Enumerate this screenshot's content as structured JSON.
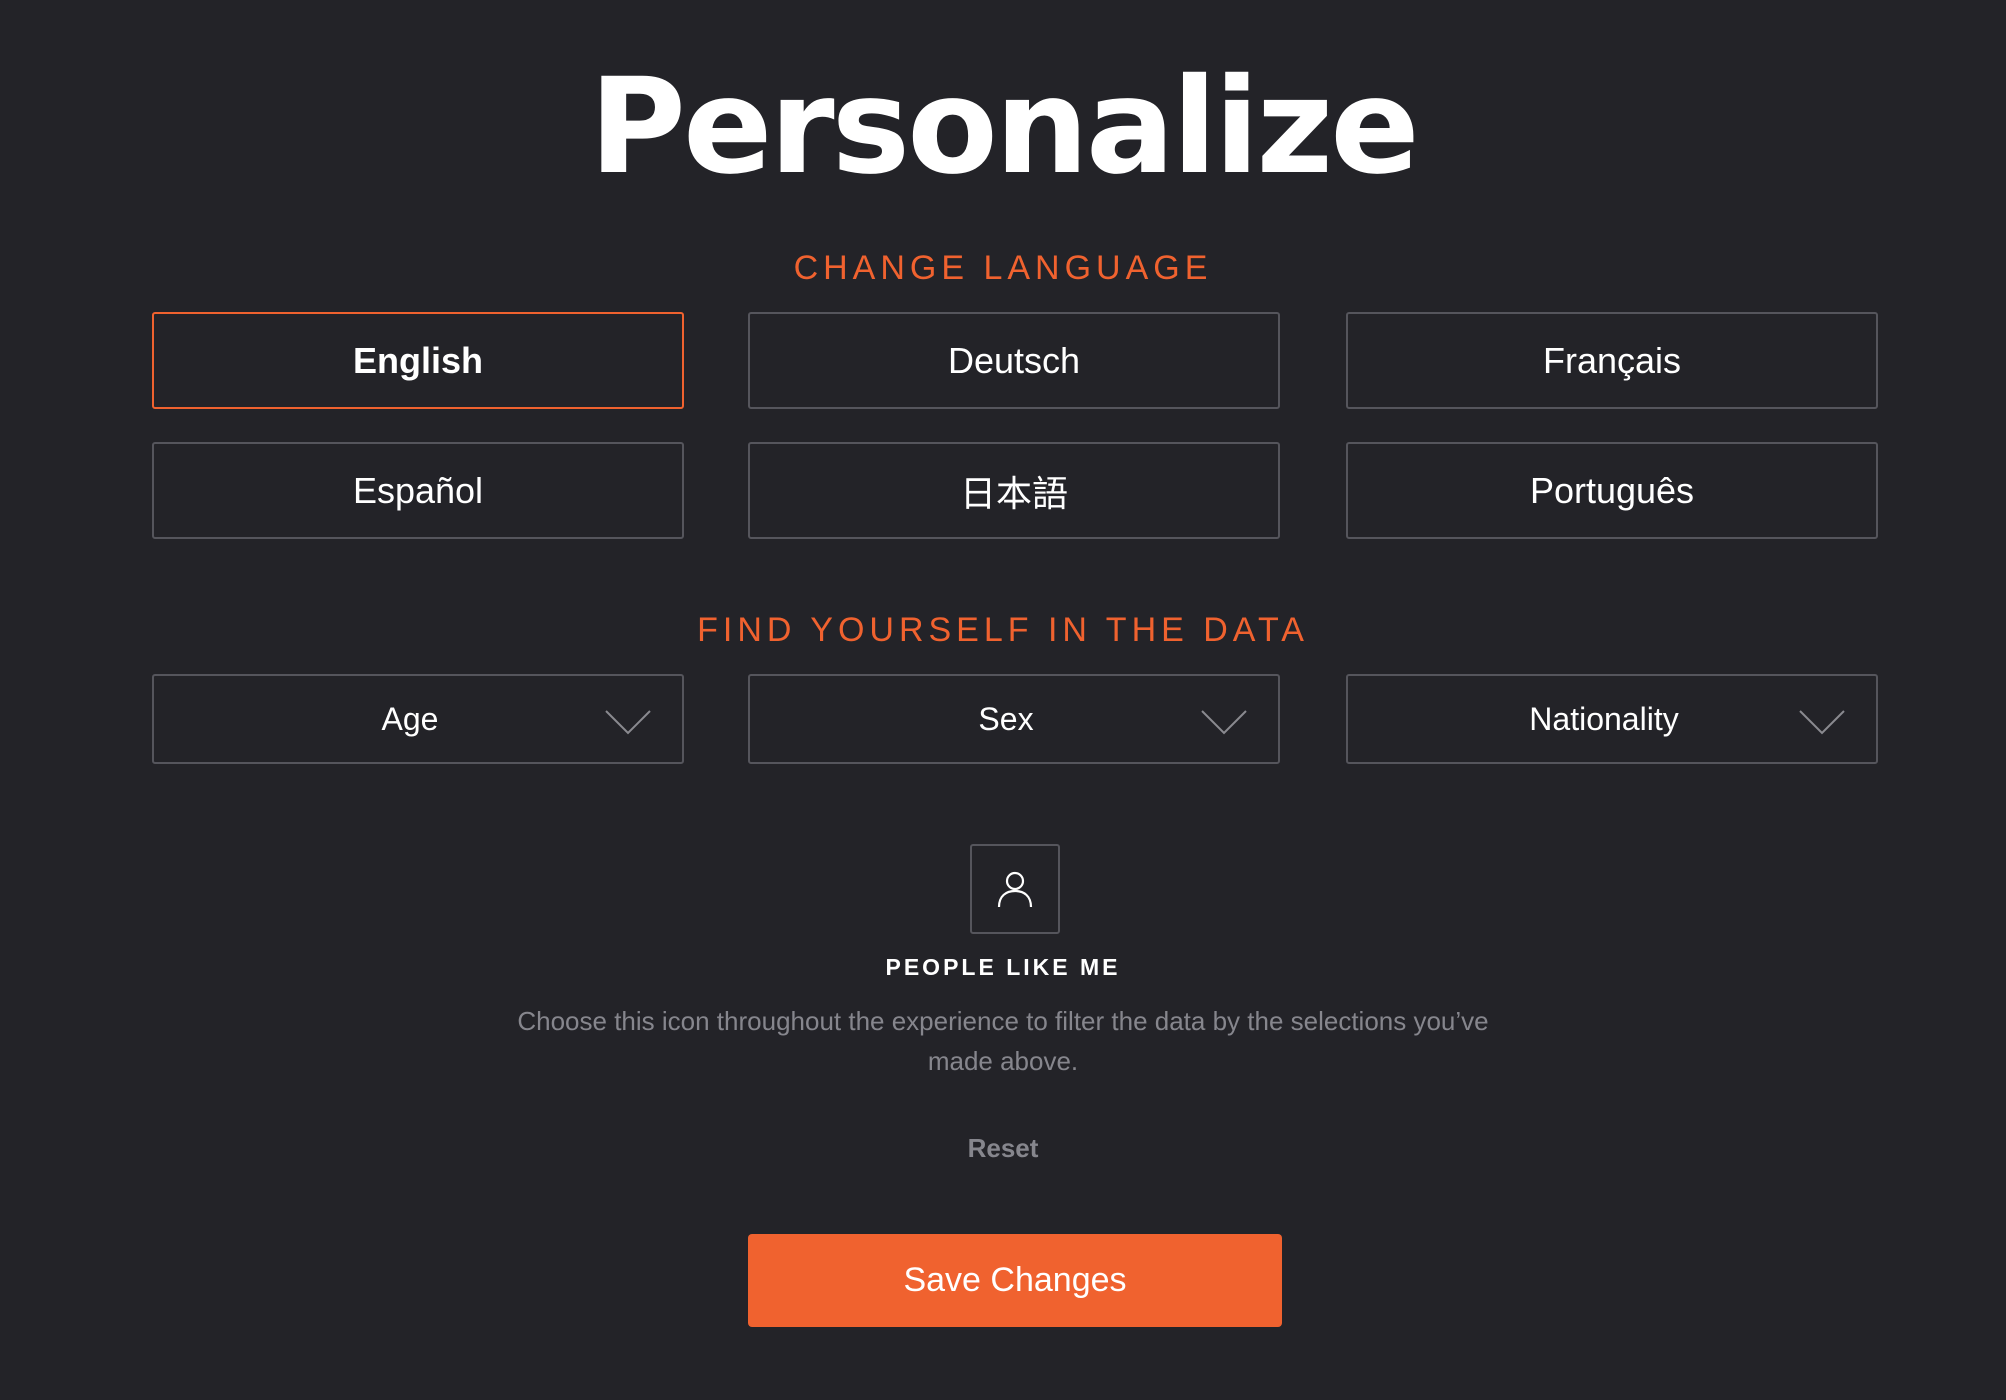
{
  "page": {
    "title": "Personalize"
  },
  "language_section": {
    "heading": "CHANGE LANGUAGE",
    "selected": "English",
    "options": [
      {
        "label": "English",
        "selected": true
      },
      {
        "label": "Deutsch",
        "selected": false
      },
      {
        "label": "Français",
        "selected": false
      },
      {
        "label": "Español",
        "selected": false
      },
      {
        "label": "日本語",
        "selected": false
      },
      {
        "label": "Português",
        "selected": false
      }
    ]
  },
  "data_section": {
    "heading": "FIND YOURSELF IN THE DATA",
    "selects": [
      {
        "label": "Age",
        "icon": "chevron-down-icon"
      },
      {
        "label": "Sex",
        "icon": "chevron-down-icon"
      },
      {
        "label": "Nationality",
        "icon": "chevron-down-icon"
      }
    ]
  },
  "people_like_me": {
    "icon": "person-icon",
    "title": "PEOPLE LIKE ME",
    "description": "Choose this icon throughout the experience to filter the data by the selections you’ve made above."
  },
  "actions": {
    "reset_label": "Reset",
    "save_label": "Save Changes"
  },
  "colors": {
    "background": "#232328",
    "accent": "#f0622f",
    "border": "#55555c",
    "muted_text": "#86868d",
    "text": "#ffffff"
  }
}
